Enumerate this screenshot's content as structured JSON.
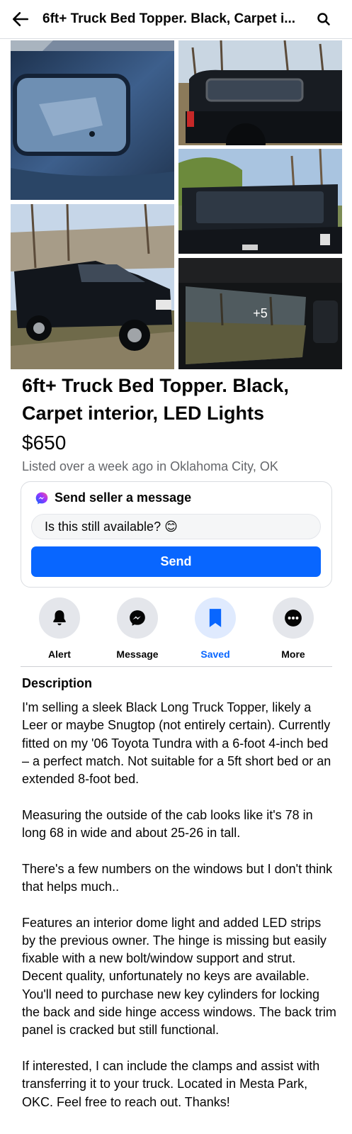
{
  "header": {
    "title": "6ft+ Truck Bed Topper. Black, Carpet i...",
    "back_icon": "arrow-left-icon",
    "search_icon": "search-icon"
  },
  "gallery": {
    "more_count": "+5"
  },
  "listing": {
    "title": "6ft+ Truck Bed Topper. Black, Carpet interior, LED Lights",
    "price": "$650",
    "listed": "Listed over a week ago in Oklahoma City, OK"
  },
  "message_card": {
    "heading": "Send seller a message",
    "input_value": "Is this still available? 😊",
    "send_label": "Send",
    "icon": "messenger-icon"
  },
  "actions": [
    {
      "label": "Alert",
      "icon": "bell-icon"
    },
    {
      "label": "Message",
      "icon": "messenger-icon"
    },
    {
      "label": "Saved",
      "icon": "bookmark-icon"
    },
    {
      "label": "More",
      "icon": "more-dots-icon"
    }
  ],
  "description": {
    "heading": "Description",
    "paragraphs": [
      "I'm selling a sleek Black Long Truck Topper, likely a Leer or maybe Snugtop (not entirely certain). Currently fitted on my '06 Toyota Tundra with a 6-foot 4-inch bed – a perfect match. Not suitable for a 5ft short bed or an extended 8-foot bed.",
      "Measuring the outside of the cab looks like it's 78 in long 68 in wide and about 25-26 in tall.",
      "There's a few numbers on the windows but I don't think that helps much..",
      "Features an interior dome light and added LED strips by the previous owner. The hinge is missing but easily fixable with a new bolt/window support and strut. Decent quality, unfortunately no keys are available. You'll need to purchase new key cylinders for locking the back and side hinge access windows. The back trim panel is cracked but still functional.",
      "If interested, I can include the clamps and assist with transferring it to your truck. Located in Mesta Park, OKC. Feel free to reach out. Thanks!"
    ]
  },
  "colors": {
    "accent": "#0866ff",
    "secondary_text": "#65676b",
    "button_bg": "#e4e6eb",
    "saved_bg": "#dfeafe"
  }
}
